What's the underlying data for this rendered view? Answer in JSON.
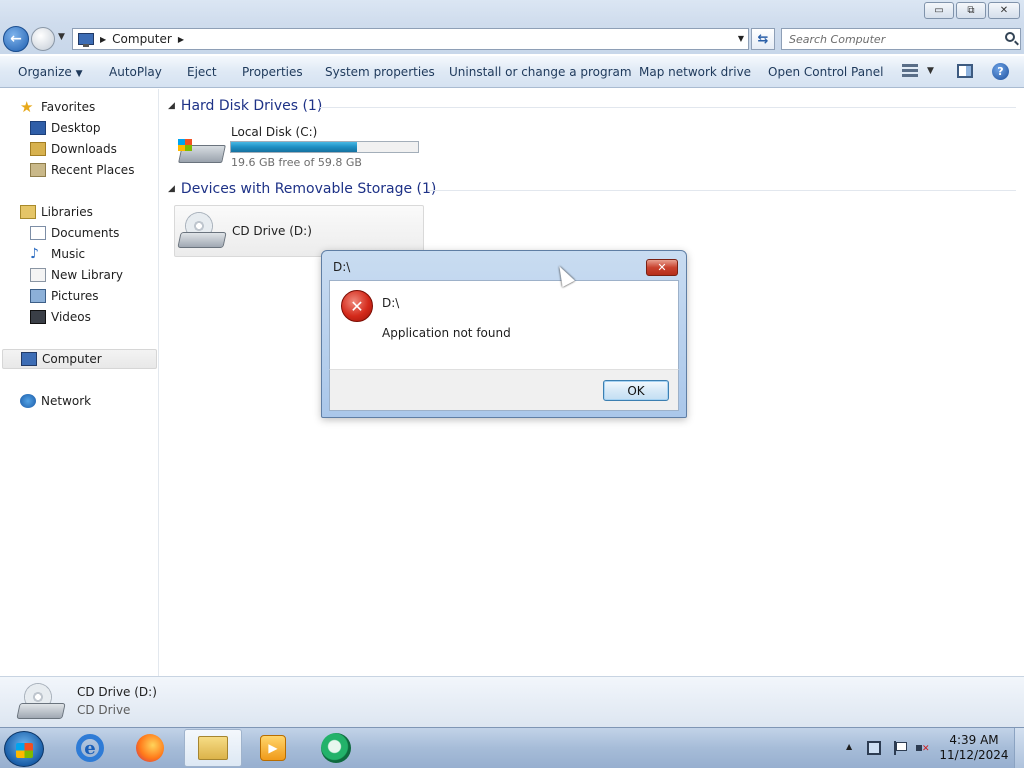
{
  "window": {
    "controls": {
      "minimize": "▭",
      "maximize": "⧉",
      "close": "✕"
    }
  },
  "address": {
    "path": "Computer",
    "search_placeholder": "Search Computer"
  },
  "toolbar": {
    "items": [
      "Organize",
      "AutoPlay",
      "Eject",
      "Properties",
      "System properties",
      "Uninstall or change a program",
      "Map network drive",
      "Open Control Panel"
    ],
    "organize_caret": "▼",
    "help": "?"
  },
  "sidebar": {
    "favorites": {
      "label": "Favorites",
      "items": [
        "Desktop",
        "Downloads",
        "Recent Places"
      ]
    },
    "libraries": {
      "label": "Libraries",
      "items": [
        "Documents",
        "Music",
        "New Library",
        "Pictures",
        "Videos"
      ]
    },
    "computer": "Computer",
    "network": "Network"
  },
  "content": {
    "hdd_group": "Hard Disk Drives (1)",
    "removable_group": "Devices with Removable Storage (1)",
    "local_disk": {
      "name": "Local Disk (C:)",
      "free_text": "19.6 GB free of 59.8 GB",
      "used_fraction": 0.672
    },
    "cd_drive": {
      "name": "CD Drive (D:)"
    }
  },
  "details": {
    "name": "CD Drive (D:)",
    "type": "CD Drive"
  },
  "dialog": {
    "title": "D:\\",
    "heading": "D:\\",
    "message": "Application not found",
    "ok": "OK",
    "close": "✕"
  },
  "tray": {
    "time": "4:39 AM",
    "date": "11/12/2024"
  },
  "taskbar": {
    "apps": [
      "internet-explorer",
      "firefox",
      "windows-explorer",
      "media-player",
      "app"
    ]
  }
}
